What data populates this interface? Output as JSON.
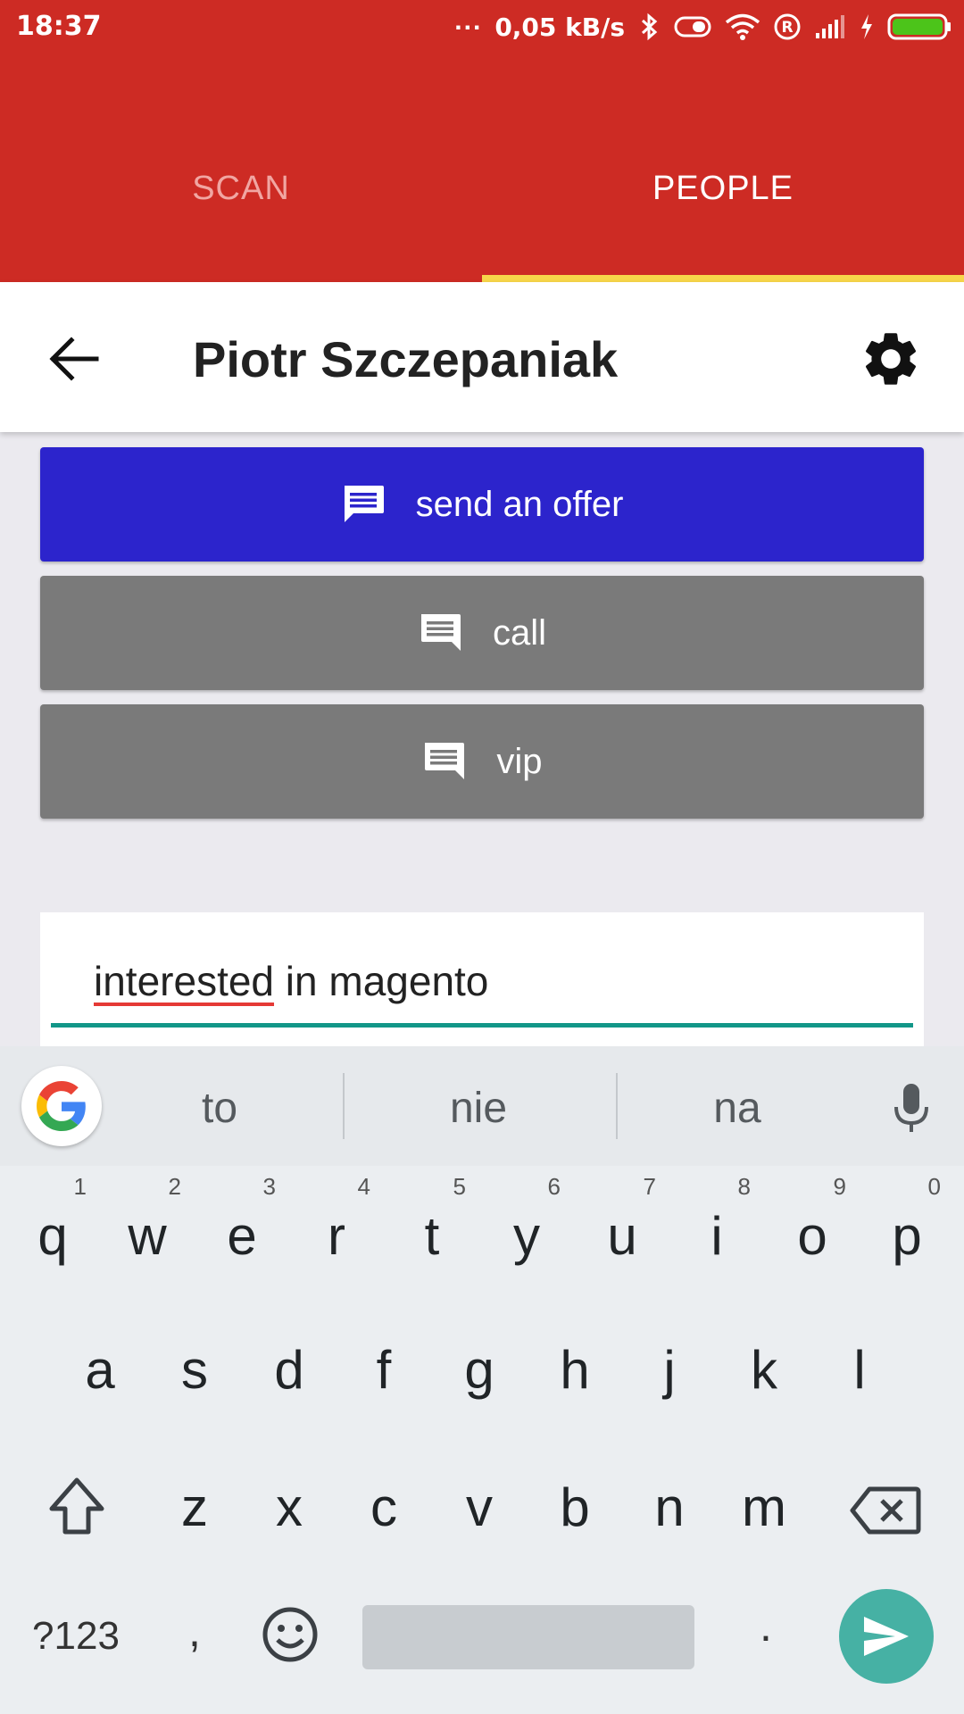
{
  "status_bar": {
    "time": "18:37",
    "dots": "...",
    "network_speed": "0,05 kB/s",
    "icons": [
      "bluetooth-icon",
      "vibrate-icon",
      "wifi-icon",
      "roaming-icon",
      "signal-icon",
      "charging-icon",
      "battery-icon"
    ]
  },
  "tabs": [
    {
      "label": "SCAN",
      "selected": false
    },
    {
      "label": "PEOPLE",
      "selected": true
    }
  ],
  "header": {
    "title": "Piotr Szczepaniak",
    "back_icon": "arrow-back-icon",
    "settings_icon": "gear-icon"
  },
  "actions": [
    {
      "label": "send an offer",
      "icon": "message-icon",
      "color": "#2c24cc"
    },
    {
      "label": "call",
      "icon": "message-icon",
      "color": "#7a7a7a"
    },
    {
      "label": "vip",
      "icon": "message-icon",
      "color": "#7a7a7a"
    }
  ],
  "note": {
    "word_misspelled": "interested",
    "word_rest": " in magento",
    "underline_color": "#129688"
  },
  "keyboard": {
    "suggestions": [
      "to",
      "nie",
      "na"
    ],
    "row1": [
      "q",
      "w",
      "e",
      "r",
      "t",
      "y",
      "u",
      "i",
      "o",
      "p"
    ],
    "row1_hints": [
      "1",
      "2",
      "3",
      "4",
      "5",
      "6",
      "7",
      "8",
      "9",
      "0"
    ],
    "row2": [
      "a",
      "s",
      "d",
      "f",
      "g",
      "h",
      "j",
      "k",
      "l"
    ],
    "row3": [
      "z",
      "x",
      "c",
      "v",
      "b",
      "n",
      "m"
    ],
    "symbols_key": "?123",
    "comma_key": ",",
    "period_key": ".",
    "accent_color": "#46b1a4"
  },
  "colors": {
    "app_bar": "#cd2b24",
    "tab_indicator": "#f7d64a"
  }
}
